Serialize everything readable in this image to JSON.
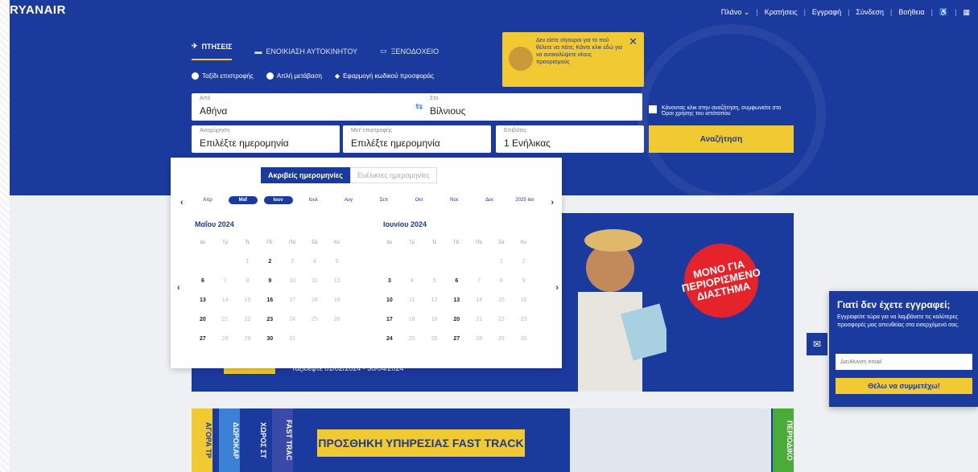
{
  "brand": {
    "logo": "RYANAIR"
  },
  "topnav": {
    "items": [
      "Πλάνο ⌄",
      "Κρατήσεις",
      "Εγγραφή",
      "Σύνδεση",
      "Βοήθεια"
    ]
  },
  "tabs": [
    {
      "label": "ΠΤΗΣΕΙΣ",
      "icon": "plane-icon"
    },
    {
      "label": "ΕΝΟΙΚΙΑΣΗ ΑΥΤΟΚΙΝΗΤΟΥ",
      "icon": "car-icon"
    },
    {
      "label": "ΞΕΝΟΔΟΧΕΙΟ",
      "icon": "bed-icon"
    }
  ],
  "trip": {
    "return": "Ταξίδι επιστροφής",
    "oneway": "Απλή μετάβαση",
    "promo": "Εφαρμογή κωδικού προσφοράς"
  },
  "promo_popup": {
    "text": "Δεν είστε σίγουροι για το πού θέλετε να πάτε; Κάντε κλικ εδώ για να ανακαλύψετε νέους προορισμούς",
    "close": "✕"
  },
  "search": {
    "from": {
      "label": "Από",
      "value": "Αθήνα"
    },
    "to": {
      "label": "Στο",
      "value": "Βίλνιους"
    },
    "depart": {
      "label": "Αναχώρηση",
      "value": "Επιλέξτε ημερομηνία"
    },
    "return": {
      "label": "Μετ' επιστροφής",
      "value": "Επιλέξτε ημερομηνία"
    },
    "pax": {
      "label": "Επιβάτες",
      "value": "1 Ενήλικας"
    },
    "terms": "Κάνοντας κλικ στην αναζήτηση, συμφωνείτε στο Όροι χρήσης του ιστότοπου",
    "button": "Αναζήτηση"
  },
  "calendar": {
    "exact": "Ακριβείς ημερομηνίες",
    "flexible": "Ευέλικτες ημερομηνίες",
    "months": [
      "Απρ",
      "Μαΐ",
      "Ιουν",
      "Ιουλ",
      "Αυγ",
      "Σεπ",
      "Οκτ",
      "Νοε",
      "Δεκ",
      "2025 Ιαν"
    ],
    "weekdays": [
      "Δε",
      "Τρ",
      "Τε",
      "Πέ",
      "Πα",
      "Σά",
      "Κυ"
    ],
    "left": {
      "title": "Μαΐου 2024"
    },
    "right": {
      "title": "Ιουνίου 2024"
    }
  },
  "banner1": {
    "sticker": "ΜΟΝΟ ΓΙΑ ΠΕΡΙΟΡΙΣΜΕΝΟ ΔΙΑΣΤΗΜΑ",
    "dates": "Ταξιδέψτε 01/02/2024 - 30/04/2024"
  },
  "banner2": {
    "bands": [
      "ΑΓΟΡΑ ΤΡ",
      "ΔΩΡΟΚΑΡ",
      "ΧΩΡΟΣ ΣΤ",
      "FAST TRAC"
    ],
    "title": "ΠΡΟΣΘΗΚΗ ΥΠΗΡΕΣΙΑΣ FAST TRACK",
    "right_band": "ΠΕΡΙΟΔΙΚΟ"
  },
  "signup": {
    "title": "Γιατί δεν έχετε εγγραφεί;",
    "text": "Εγγραφείτε τώρα για να λαμβάνετε τις καλύτερες προσφορές μας απευθείας στα εισερχόμενό σας.",
    "placeholder": "Διεύθυνση email",
    "button": "Θέλω να συμμετέχω!"
  },
  "colors": {
    "brand": "#1b3a9e",
    "accent": "#f1c933"
  }
}
